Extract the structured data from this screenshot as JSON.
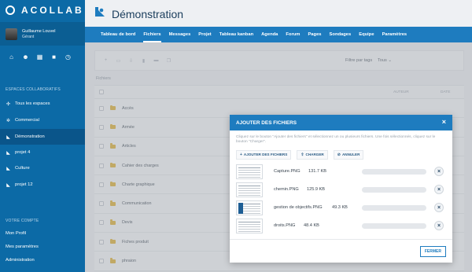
{
  "app": {
    "logo": "ACOLLAB"
  },
  "user": {
    "name": "Guillaume Louvel",
    "role": "Gérant"
  },
  "sidebar": {
    "spaces_header": "ESPACES COLLABORATIFS",
    "spaces": [
      {
        "label": "Tous les espaces",
        "icon": "network-icon"
      },
      {
        "label": "Commercial",
        "icon": "gear-icon"
      },
      {
        "label": "Démonstration",
        "icon": "app-icon",
        "active": true
      },
      {
        "label": "projet 4",
        "icon": "app-icon"
      },
      {
        "label": "Culture",
        "icon": "app-icon"
      },
      {
        "label": "projet 12",
        "icon": "app-icon"
      }
    ],
    "account_header": "VOTRE COMPTE",
    "account_links": [
      "Mon Profil",
      "Mes paramètres",
      "Administration"
    ]
  },
  "header": {
    "title": "Démonstration"
  },
  "nav": {
    "items": [
      "Tableau de bord",
      "Fichiers",
      "Messages",
      "Projet",
      "Tableau kanban",
      "Agenda",
      "Forum",
      "Pages",
      "Sondages",
      "Equipe",
      "Paramètres"
    ],
    "active": "Fichiers"
  },
  "toolbar": {
    "filter_label": "Filtre par tags",
    "filter_value": "Tous"
  },
  "files": {
    "breadcrumb": "Fichiers",
    "col_author": "AUTEUR",
    "col_date": "DATE",
    "folders": [
      "Accès",
      "Armée",
      "Articles",
      "Cahier des charges",
      "Charte graphique",
      "Communication",
      "Devis",
      "Fiches produit",
      "phraion"
    ]
  },
  "modal": {
    "title": "AJOUTER DES FICHIERS",
    "help": "Cliquez sur le bouton \"Ajouter des fichiers\" et sélectionnez un ou plusieurs fichiers. Une fois sélectionnés, cliquez sur le bouton \"Charger\".",
    "btn_add": "AJOUTER DES FICHIERS",
    "btn_upload": "CHARGER",
    "btn_cancel": "ANNULER",
    "files": [
      {
        "name": "Capture.PNG",
        "size": "131.7 KB"
      },
      {
        "name": "chemin.PNG",
        "size": "125.9 KB"
      },
      {
        "name": "gestion de objectifs.PNG",
        "size": "49.3 KB"
      },
      {
        "name": "droits.PNG",
        "size": "48.4 KB"
      }
    ],
    "btn_close": "FERMER"
  }
}
